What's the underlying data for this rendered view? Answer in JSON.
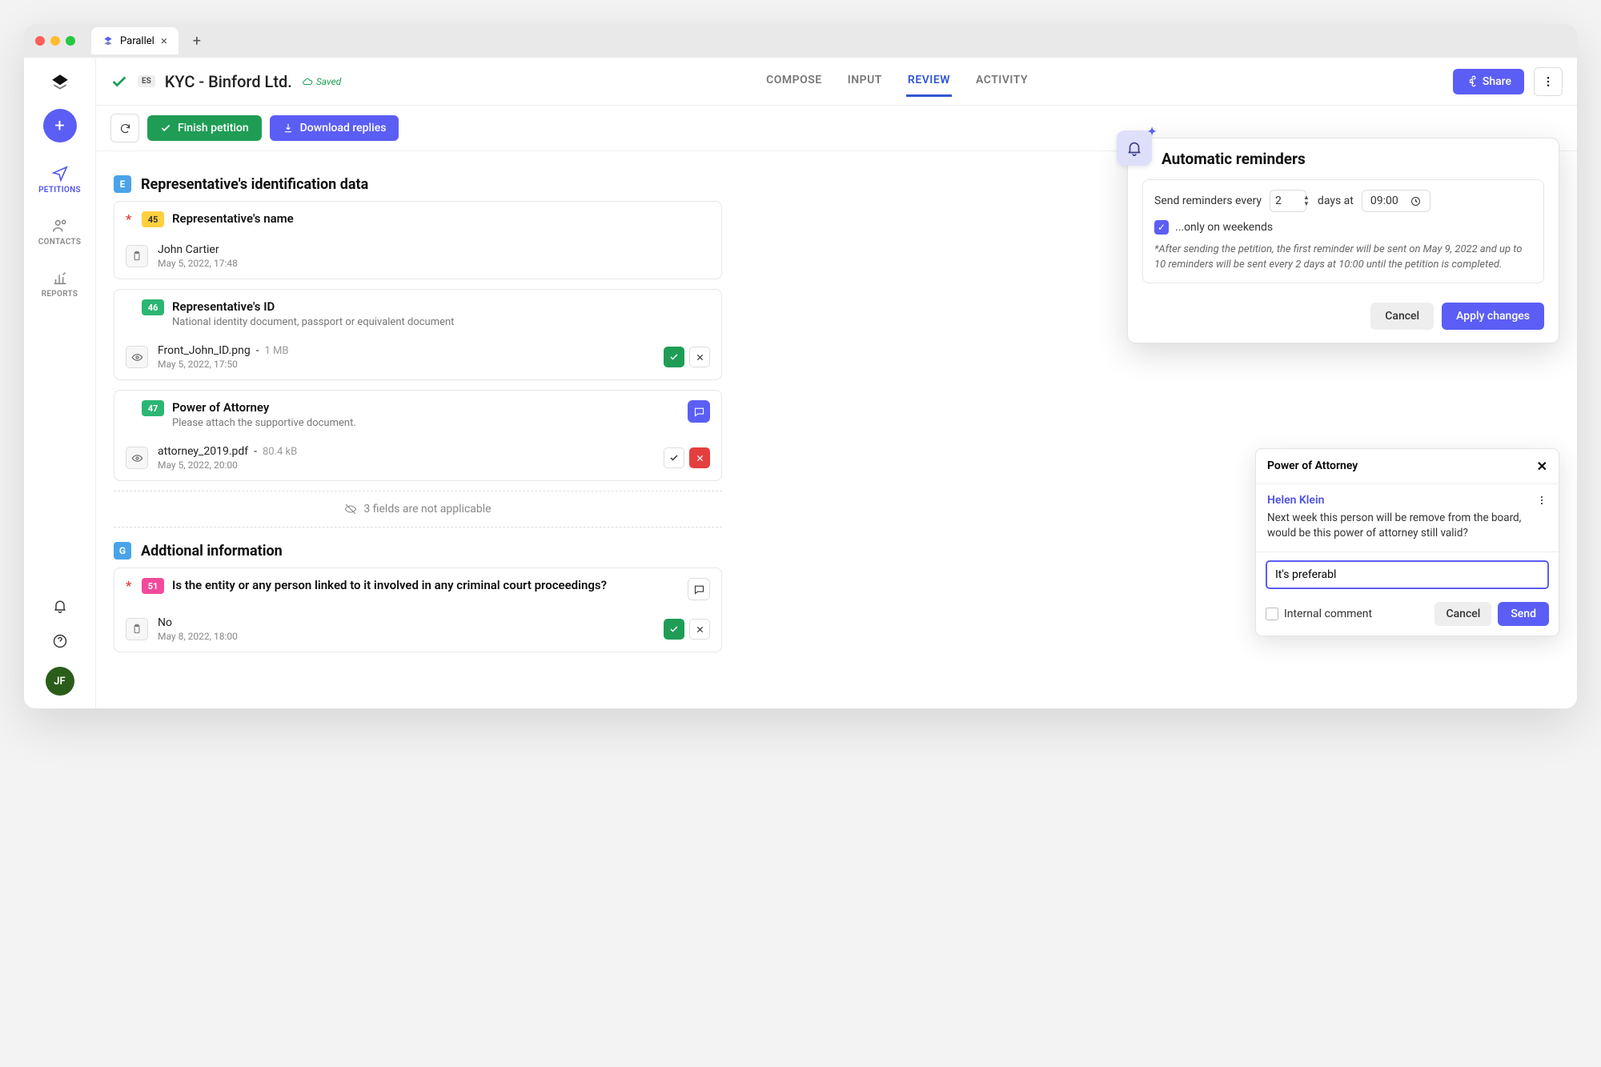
{
  "tab": {
    "title": "Parallel"
  },
  "header": {
    "es_badge": "ES",
    "title": "KYC - Binford Ltd.",
    "saved": "Saved",
    "tabs": {
      "compose": "COMPOSE",
      "input": "INPUT",
      "review": "REVIEW",
      "activity": "ACTIVITY"
    },
    "share": "Share"
  },
  "toolbar": {
    "finish": "Finish petition",
    "download": "Download replies"
  },
  "sidenav": {
    "petitions": "PETITIONS",
    "contacts": "CONTACTS",
    "reports": "REPORTS",
    "avatar": "JF"
  },
  "sections": {
    "e": {
      "letter": "E",
      "title": "Representative's identification data"
    },
    "g": {
      "letter": "G",
      "title": "Addtional information"
    }
  },
  "cards": {
    "c45": {
      "num": "45",
      "title": "Representative's name",
      "value": "John Cartier",
      "meta": "May 5, 2022, 17:48"
    },
    "c46": {
      "num": "46",
      "title": "Representative's ID",
      "sub": "National identity document, passport or equivalent document",
      "file": "Front_John_ID.png",
      "size": "1 MB",
      "meta": "May 5, 2022, 17:50"
    },
    "c47": {
      "num": "47",
      "title": "Power of Attorney",
      "sub": "Please attach the supportive document.",
      "file": "attorney_2019.pdf",
      "size": "80.4 kB",
      "meta": "May 5, 2022, 20:00"
    },
    "c51": {
      "num": "51",
      "title": "Is the entity or any person linked to it involved in any criminal court proceedings?",
      "value": "No",
      "meta": "May 8, 2022, 18:00"
    }
  },
  "na_row": "3 fields are not applicable",
  "popover": {
    "title": "Automatic reminders",
    "t1": "Send reminders every",
    "days_val": "2",
    "t2": "days at",
    "time_val": "09:00",
    "chk_label": "...only on weekends",
    "note": "*After sending the petition, the first reminder will be sent on May 9, 2022 and up to 10 reminders will be sent every 2 days at 10:00 until the petition is completed.",
    "cancel": "Cancel",
    "apply": "Apply changes"
  },
  "comment": {
    "head": "Power of Attorney",
    "name": "Helen Klein",
    "text": "Next week this person will be remove from the board, would be this power of attorney still valid?",
    "input": "It's preferabl",
    "internal": "Internal comment",
    "cancel": "Cancel",
    "send": "Send"
  }
}
